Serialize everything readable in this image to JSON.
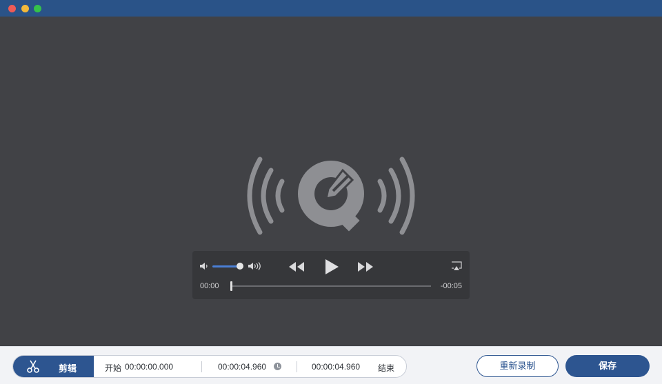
{
  "window": {
    "buttons": [
      "close",
      "minimize",
      "maximize"
    ],
    "colors": {
      "titlebar": "#2a5388",
      "close": "#ee5b57",
      "minimize": "#f2b93a",
      "maximize": "#35c24a"
    }
  },
  "player": {
    "logo_icon": "quicktime-logo-icon",
    "volume_level": 0.75,
    "current_time": "00:00",
    "remaining_time": "-00:05",
    "progress": 0,
    "icons": [
      "volume-low-icon",
      "volume-high-icon",
      "rewind-icon",
      "play-icon",
      "fast-forward-icon",
      "airplay-icon"
    ]
  },
  "toolbar": {
    "trim_icon": "scissors-icon",
    "trim_label": "剪辑",
    "start_label": "开始",
    "start_time": "00:00:00.000",
    "duration": "00:00:04.960",
    "end_time": "00:00:04.960",
    "end_label": "结束",
    "rerecord_label": "重新录制",
    "save_label": "保存",
    "accent_color": "#2d5590"
  }
}
